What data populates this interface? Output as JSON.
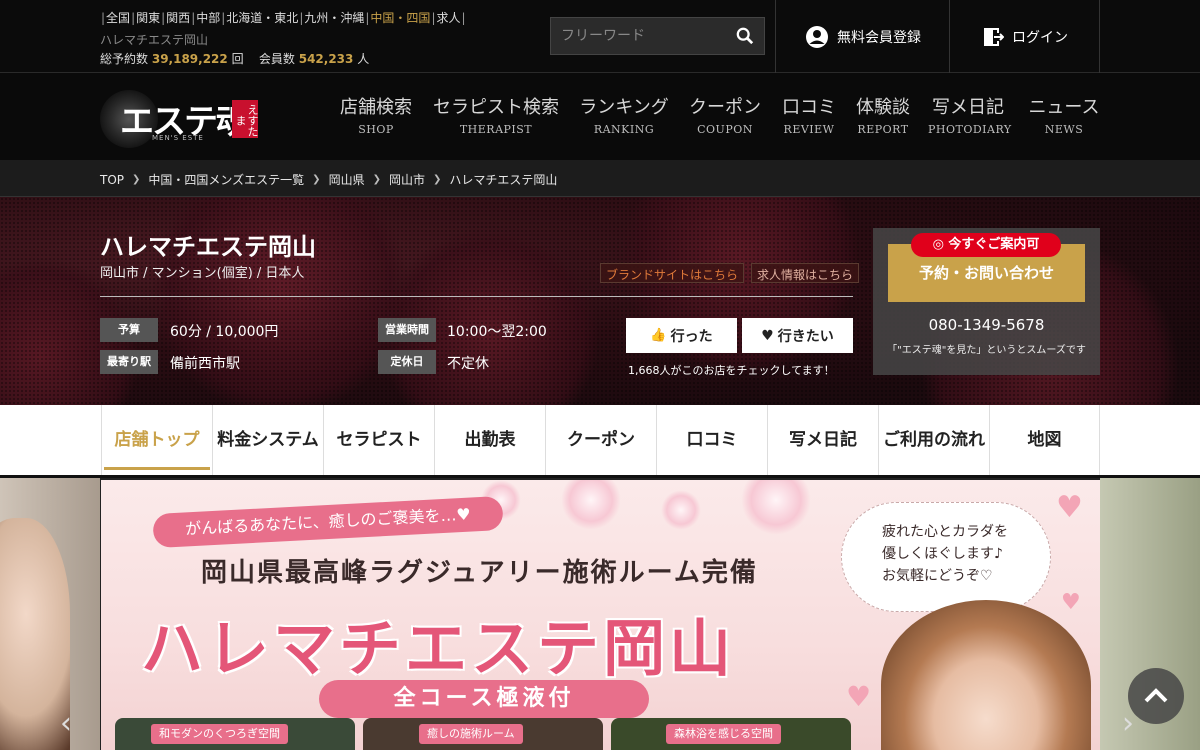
{
  "topbar": {
    "regions": [
      "全国",
      "関東",
      "関西",
      "中部",
      "北海道・東北",
      "九州・沖縄",
      "中国・四国",
      "求人"
    ],
    "active_region": "中国・四国",
    "shop_name": "ハレマチエステ岡山",
    "reservations_label": "総予約数",
    "reservations_value": "39,189,222",
    "reservations_unit": "回",
    "members_label": "会員数",
    "members_value": "542,233",
    "members_unit": "人",
    "search_placeholder": "フリーワード",
    "register_label": "無料会員登録",
    "login_label": "ログイン"
  },
  "logo": {
    "text": "エステ魂",
    "badge": "えすたま",
    "sub": "MEN'S ESTE"
  },
  "nav": [
    {
      "jp": "店舗検索",
      "en": "SHOP"
    },
    {
      "jp": "セラピスト検索",
      "en": "THERAPIST"
    },
    {
      "jp": "ランキング",
      "en": "RANKING"
    },
    {
      "jp": "クーポン",
      "en": "COUPON"
    },
    {
      "jp": "口コミ",
      "en": "REVIEW"
    },
    {
      "jp": "体験談",
      "en": "REPORT"
    },
    {
      "jp": "写メ日記",
      "en": "PHOTODIARY"
    },
    {
      "jp": "ニュース",
      "en": "NEWS"
    }
  ],
  "breadcrumb": [
    "TOP",
    "中国・四国メンズエステ一覧",
    "岡山県",
    "岡山市",
    "ハレマチエステ岡山"
  ],
  "shop": {
    "name": "ハレマチエステ岡山",
    "meta": "岡山市 / マンション(個室) / 日本人",
    "brand_link": "ブランドサイトはこちら",
    "recruit_link": "求人情報はこちら",
    "budget_label": "予算",
    "budget_value": "60分 / 10,000円",
    "hours_label": "営業時間",
    "hours_value": "10:00～翌2:00",
    "station_label": "最寄り駅",
    "station_value": "備前西市駅",
    "holiday_label": "定休日",
    "holiday_value": "不定休",
    "went_label": "行った",
    "want_label": "行きたい",
    "check_note": "1,668人がこのお店をチェックしてます！"
  },
  "reserve": {
    "now_label": "◎ 今すぐご案内可",
    "button_label": "予約・お問い合わせ",
    "tel": "080-1349-5678",
    "note": "「\"エステ魂\"を見た」というとスムーズです"
  },
  "tabs": [
    "店舗トップ",
    "料金システム",
    "セラピスト",
    "出勤表",
    "クーポン",
    "口コミ",
    "写メ日記",
    "ご利用の流れ",
    "地図"
  ],
  "active_tab": "店舗トップ",
  "banner": {
    "pill": "がんばるあなたに、癒しのご褒美を…♥",
    "headline": "岡山県最高峰ラグジュアリー施術ルーム完備",
    "title": "ハレマチエステ岡山",
    "course": "全コース極液付",
    "bubble_lines": [
      "疲れた心とカラダを",
      "優しくほぐします♪",
      "お気軽にどうぞ♡"
    ],
    "photo_labels": [
      "和モダンのくつろぎ空間",
      "癒しの施術ルーム",
      "森林浴を感じる空間"
    ]
  },
  "colors": {
    "gold": "#c9a24a",
    "red": "#e0001b",
    "pink": "#e86f8b"
  }
}
